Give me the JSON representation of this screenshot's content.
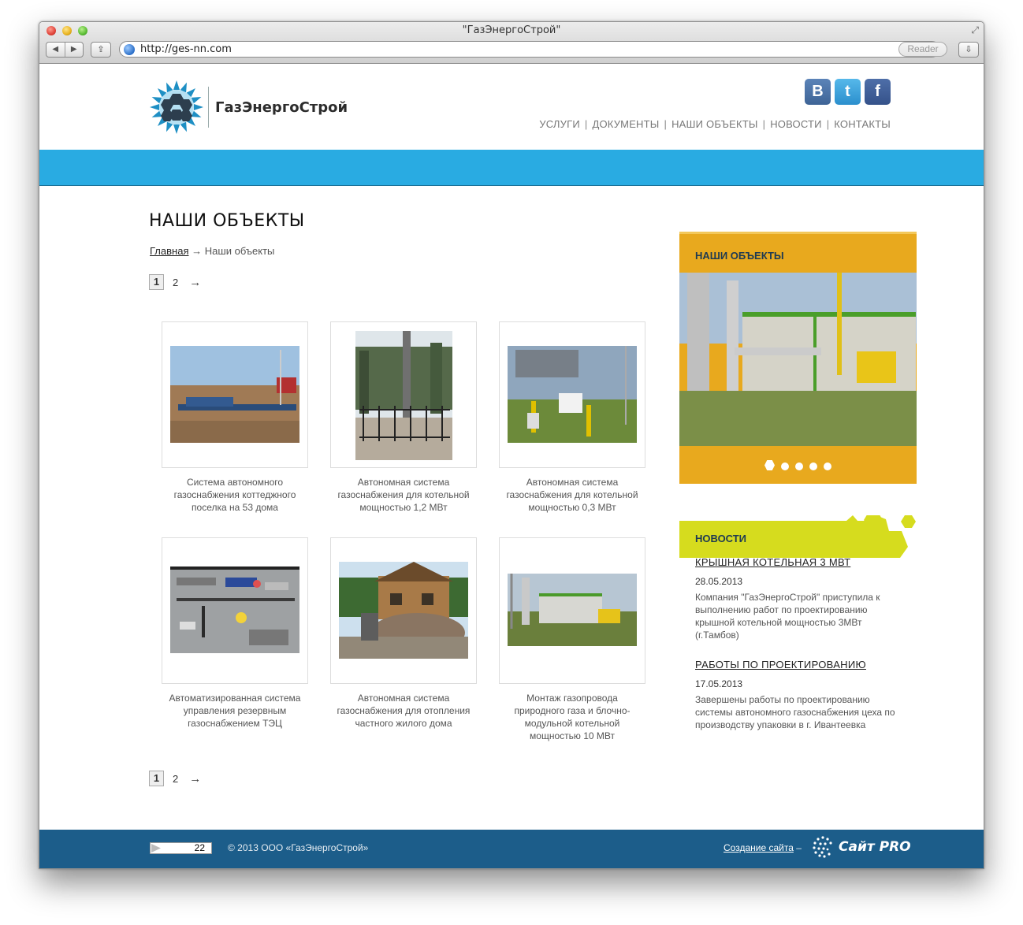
{
  "browser": {
    "window_title": "\"ГазЭнергоСтрой\"",
    "back_icon": "◀",
    "forward_icon": "▶",
    "share_icon": "⇪",
    "url": "http://ges-nn.com",
    "reload_icon": "↻",
    "reader_label": "Reader",
    "download_icon": "⇩",
    "resize_icon": "⤢"
  },
  "header": {
    "logo_text": "ГазЭнергоСтрой",
    "social": {
      "vk": "B",
      "twitter": "t",
      "facebook": "f"
    },
    "nav": [
      "УСЛУГИ",
      "ДОКУМЕНТЫ",
      "НАШИ ОБЪЕКТЫ",
      "НОВОСТИ",
      "КОНТАКТЫ"
    ],
    "nav_separator": "|",
    "band_color": "#29abe2"
  },
  "main": {
    "title": "НАШИ ОБЪЕКТЫ",
    "breadcrumb_home": "Главная",
    "breadcrumb_arrow": "→",
    "breadcrumb_current": "Наши объекты",
    "pager": {
      "current": "1",
      "next_page": "2",
      "arrow": "→"
    },
    "objects": [
      {
        "caption": "Система автономного газоснабжения коттеджного поселка на 53 дома"
      },
      {
        "caption": "Автономная система газоснабжения для котельной мощностью 1,2 МВт"
      },
      {
        "caption": "Автономная система газоснабжения для котельной мощностью 0,3 МВт"
      },
      {
        "caption": "Автоматизированная система управления резервным газоснабжением ТЭЦ"
      },
      {
        "caption": "Автономная система газоснабжения для отопления частного жилого дома"
      },
      {
        "caption": "Монтаж газопровода природного газа и блочно-модульной котельной мощностью 10 МВт"
      }
    ]
  },
  "sidebar": {
    "objects_title": "НАШИ ОБЪЕКТЫ",
    "slider_dots": 5,
    "slider_active": 1,
    "news_title": "НОВОСТИ",
    "news": [
      {
        "heading": "КРЫШНАЯ КОТЕЛЬНАЯ 3 МВТ",
        "date": "28.05.2013",
        "text": "Компания \"ГазЭнергоСтрой\" приступила к выполнению работ по проектированию крышной котельной мощностью 3МВт (г.Тамбов)"
      },
      {
        "heading": "РАБОТЫ ПО ПРОЕКТИРОВАНИЮ",
        "date": "17.05.2013",
        "text": "Завершены работы по проектированию системы автономного газоснабжения цеха по производству упаковки в г. Ивантеевка"
      }
    ]
  },
  "footer": {
    "counter_value": "22",
    "copyright": "© 2013 ООО «ГазЭнергоСтрой»",
    "credit_link": "Создание сайта",
    "credit_dash": " –",
    "credit_brand": "Сайт PRO",
    "bg_color": "#1c5d8a"
  }
}
